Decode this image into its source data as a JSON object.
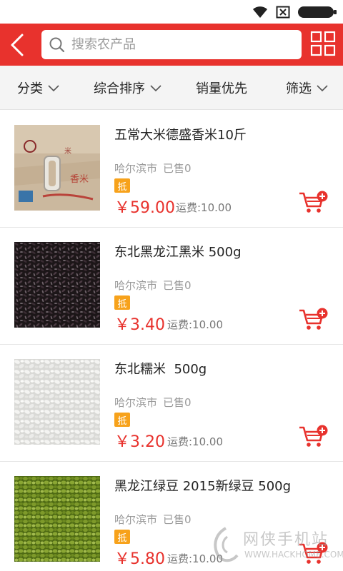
{
  "colors": {
    "accent": "#e8322d",
    "badge": "#f7a21b",
    "muted": "#9a9a9a"
  },
  "status_bar": {
    "icons": [
      "wifi-icon",
      "sim-icon",
      "battery-icon"
    ]
  },
  "header": {
    "back_icon": "back-chevron-icon",
    "search": {
      "placeholder": "搜索农产品",
      "icon": "search-icon"
    },
    "view_toggle_icon": "grid-view-icon"
  },
  "filters": [
    {
      "label": "分类",
      "has_dropdown": true
    },
    {
      "label": "综合排序",
      "has_dropdown": true
    },
    {
      "label": "销量优先",
      "has_dropdown": false
    },
    {
      "label": "筛选",
      "has_dropdown": true
    }
  ],
  "products": [
    {
      "name": "五常大米德盛香米10斤",
      "city": "哈尔滨市",
      "sold": "已售0",
      "badge": "抵",
      "price": "￥59.00",
      "shipping": "运费:10.00",
      "image": "rice-bag-image"
    },
    {
      "name": "东北黑龙江黑米 500g",
      "city": "哈尔滨市",
      "sold": "已售0",
      "badge": "抵",
      "price": "￥3.40",
      "shipping": "运费:10.00",
      "image": "black-rice-image"
    },
    {
      "name": "东北糯米  500g",
      "city": "哈尔滨市",
      "sold": "已售0",
      "badge": "抵",
      "price": "￥3.20",
      "shipping": "运费:10.00",
      "image": "glutinous-rice-image"
    },
    {
      "name": "黑龙江绿豆 2015新绿豆 500g",
      "city": "哈尔滨市",
      "sold": "已售0",
      "badge": "抵",
      "price": "￥5.80",
      "shipping": "运费:10.00",
      "image": "mung-bean-image"
    }
  ],
  "watermark": {
    "cn": "网侠手机站",
    "en": "WWW.HACKHOME.COM"
  }
}
